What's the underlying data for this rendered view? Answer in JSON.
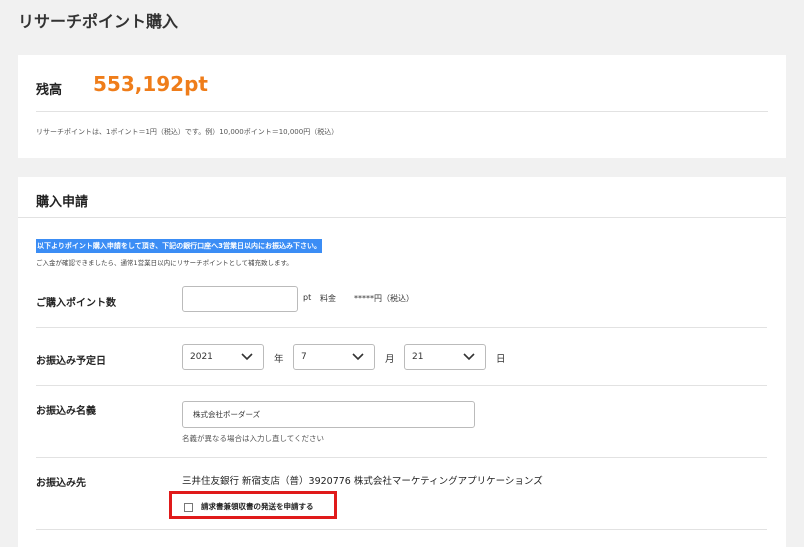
{
  "page": {
    "title": "リサーチポイント購入"
  },
  "balance": {
    "label": "残高",
    "value": "553,192pt",
    "note": "リサーチポイントは、1ポイント＝1円（税込）です。例）10,000ポイント＝10,000円（税込）",
    "accent_color": "#ef7d1a"
  },
  "purchase": {
    "title": "購入申請",
    "notice": "以下よりポイント購入申請をして頂き、下記の銀行口座へ3営業日以内にお振込み下さい。",
    "notice_sub": "ご入金が確認できましたら、通常1営業日以内にリサーチポイントとして補充致します。",
    "points": {
      "label": "ご購入ポイント数",
      "value": "",
      "unit": "pt",
      "fee_label": "料金",
      "fee_value": "*****円（税込）"
    },
    "transfer_date": {
      "label": "お振込み予定日",
      "year": "2021",
      "year_unit": "年",
      "month": "7",
      "month_unit": "月",
      "day": "21",
      "day_unit": "日"
    },
    "transfer_name": {
      "label": "お振込み名義",
      "value": "株式会社ポーダーズ",
      "hint": "名義が異なる場合は入力し直してください"
    },
    "destination": {
      "label": "お振込み先",
      "value": "三井住友銀行 新宿支店（普）3920776 株式会社マーケティングアプリケーションズ",
      "checkbox_label": "請求書兼領収書の発送を申請する",
      "checkbox_checked": false
    }
  }
}
